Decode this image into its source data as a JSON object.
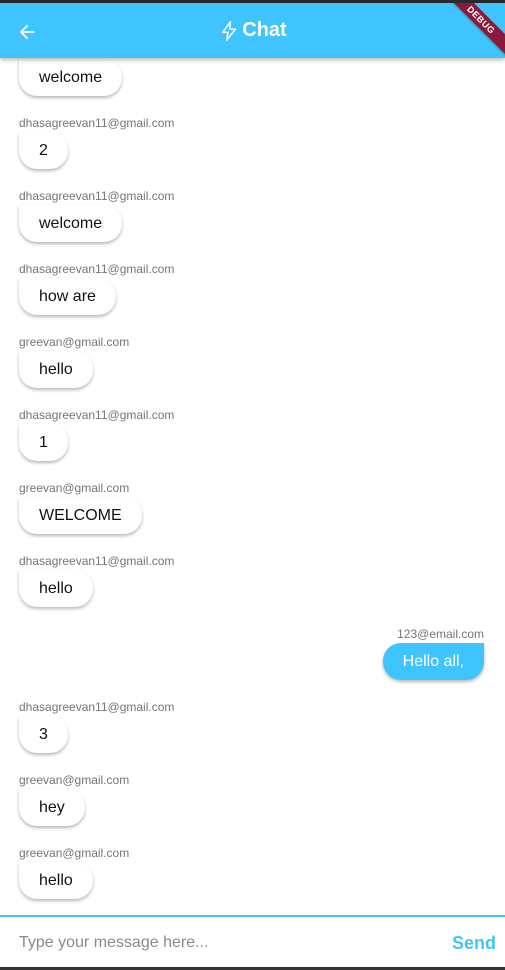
{
  "app_bar": {
    "title": "Chat",
    "back_icon": "arrow-left-icon",
    "title_icon": "lightning-bolt-icon",
    "color": "#40c4ff"
  },
  "debug_banner": {
    "label": "DEBUG"
  },
  "messages": [
    {
      "sender": "",
      "text": "welcome",
      "from_me": false
    },
    {
      "sender": "dhasagreevan11@gmail.com",
      "text": "2",
      "from_me": false
    },
    {
      "sender": "dhasagreevan11@gmail.com",
      "text": "welcome",
      "from_me": false
    },
    {
      "sender": "dhasagreevan11@gmail.com",
      "text": "how are",
      "from_me": false
    },
    {
      "sender": "greevan@gmail.com",
      "text": "hello",
      "from_me": false
    },
    {
      "sender": "dhasagreevan11@gmail.com",
      "text": "1",
      "from_me": false
    },
    {
      "sender": "greevan@gmail.com",
      "text": "WELCOME",
      "from_me": false
    },
    {
      "sender": "dhasagreevan11@gmail.com",
      "text": "hello",
      "from_me": false
    },
    {
      "sender": "123@email.com",
      "text": "Hello all,",
      "from_me": true
    },
    {
      "sender": "dhasagreevan11@gmail.com",
      "text": "3",
      "from_me": false
    },
    {
      "sender": "greevan@gmail.com",
      "text": "hey",
      "from_me": false
    },
    {
      "sender": "greevan@gmail.com",
      "text": "hello",
      "from_me": false
    }
  ],
  "composer": {
    "placeholder": "Type your message here...",
    "value": "",
    "send_label": "Send"
  },
  "colors": {
    "accent": "#40c4ff",
    "incoming_bubble": "#ffffff",
    "outgoing_bubble": "#40c4ff",
    "sender_text": "#757575"
  }
}
